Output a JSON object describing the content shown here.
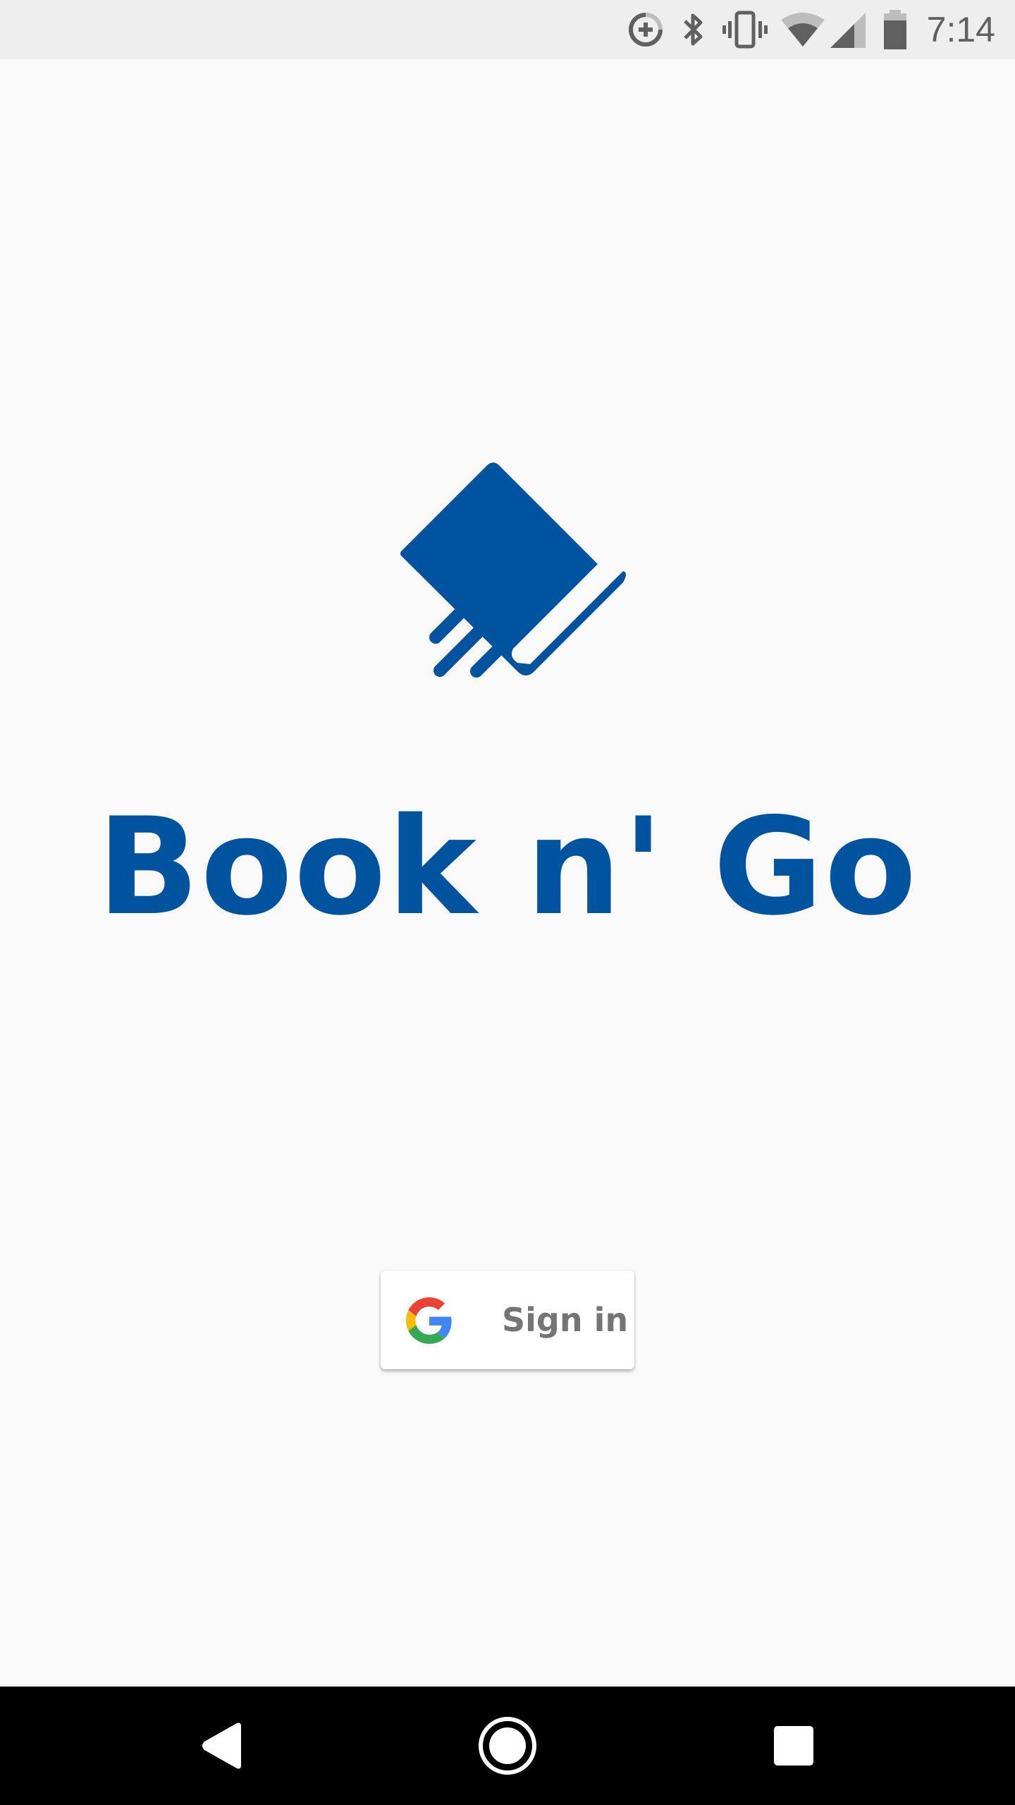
{
  "status_bar": {
    "time": "7:14",
    "icons": [
      "data-saver-icon",
      "bluetooth-icon",
      "vibrate-icon",
      "wifi-icon",
      "cell-signal-icon",
      "battery-icon"
    ]
  },
  "app": {
    "title": "Book n' Go",
    "logo_icon": "flying-book-icon",
    "brand_color": "#00539f"
  },
  "signin": {
    "label": "Sign in",
    "icon": "google-g-icon",
    "colors": {
      "red": "#ea4335",
      "yellow": "#fbbc05",
      "green": "#34a853",
      "blue": "#4285f4"
    }
  },
  "nav_bar": {
    "buttons": [
      "back-icon",
      "home-icon",
      "recents-icon"
    ]
  }
}
